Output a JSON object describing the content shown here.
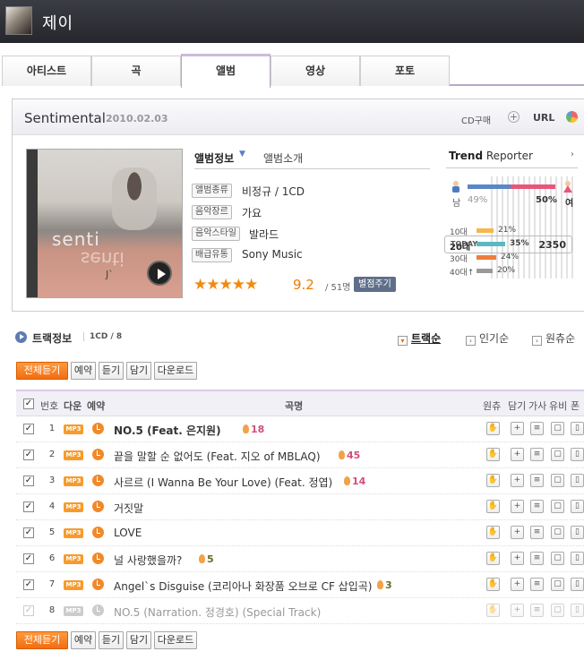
{
  "header": {
    "artist_name": "제이"
  },
  "tabs": [
    {
      "label": "아티스트",
      "active": false
    },
    {
      "label": "곡",
      "active": false
    },
    {
      "label": "앨범",
      "active": true
    },
    {
      "label": "영상",
      "active": false
    },
    {
      "label": "포토",
      "active": false
    }
  ],
  "album": {
    "title": "Sentimental",
    "date": "2010.02.03",
    "cd_buy": "CD구매",
    "url_label": "URL",
    "cover_text": "senti",
    "cover_signature": "J`",
    "info_tab_active": "앨범정보",
    "info_tab_other": "앨범소개",
    "info": [
      {
        "label": "앨범종류",
        "value": "비정규 / 1CD"
      },
      {
        "label": "음악장르",
        "value": "가요"
      },
      {
        "label": "음악스타일",
        "value": "발라드"
      },
      {
        "label": "배급유통",
        "value": "Sony Music"
      }
    ],
    "rating": {
      "stars": "★★★★★",
      "score": "9.2",
      "count": "/ 51명",
      "rate_button": "별점주기"
    }
  },
  "trend": {
    "title_bold": "Trend",
    "title_rest": " Reporter",
    "male_label": "남",
    "female_label": "여",
    "male_pct": "49%",
    "female_pct": "50%",
    "male_value": 49,
    "female_value": 50,
    "ages": [
      {
        "label": "10대",
        "pct": "21%",
        "value": 21,
        "color": "#f5b74c",
        "highlight": false
      },
      {
        "label": "20대",
        "pct": "35%",
        "value": 35,
        "color": "#5ab9c4",
        "highlight": true
      },
      {
        "label": "30대",
        "pct": "24%",
        "value": 24,
        "color": "#ef7d3c",
        "highlight": false
      },
      {
        "label": "40대↑",
        "pct": "20%",
        "value": 20,
        "color": "#9a9a9a",
        "highlight": false
      }
    ],
    "today_label": "TODAY",
    "today_value": "2350"
  },
  "tracklist": {
    "title": "트랙정보",
    "cd_info": "1CD / 8",
    "sort_options": [
      "트랙순",
      "인기순",
      "원츄순"
    ],
    "buttons": [
      "전체듣기",
      "예약",
      "듣기",
      "담기",
      "다운로드"
    ],
    "columns": {
      "num": "번호",
      "down": "다운",
      "reserve": "예약",
      "title": "곡명",
      "wonchu": "원츄",
      "add": "담기",
      "lyrics": "가사",
      "yubi": "유비",
      "phone": "폰"
    },
    "tracks": [
      {
        "num": "1",
        "title": "NO.5 (Feat. 은지원)",
        "fire": "18",
        "bold": true,
        "disabled": false
      },
      {
        "num": "2",
        "title": "끝을 말할 순 없어도 (Feat. 지오 of MBLAQ)",
        "fire": "45",
        "bold": false,
        "disabled": false
      },
      {
        "num": "3",
        "title": "사르르 (I Wanna Be Your Love) (Feat. 정엽)",
        "fire": "14",
        "bold": false,
        "disabled": false
      },
      {
        "num": "4",
        "title": "거짓말",
        "fire": "",
        "bold": false,
        "disabled": false
      },
      {
        "num": "5",
        "title": "LOVE",
        "fire": "",
        "bold": false,
        "disabled": false
      },
      {
        "num": "6",
        "title": "널 사랑했을까?",
        "fire": "5",
        "bold": false,
        "disabled": false
      },
      {
        "num": "7",
        "title": "Angel`s Disguise (코리아나 화장품 오브로 CF 삽입곡)",
        "fire": "3",
        "bold": false,
        "disabled": false
      },
      {
        "num": "8",
        "title": "NO.5 (Narration. 정경호) (Special Track)",
        "fire": "",
        "bold": false,
        "disabled": true
      }
    ]
  }
}
